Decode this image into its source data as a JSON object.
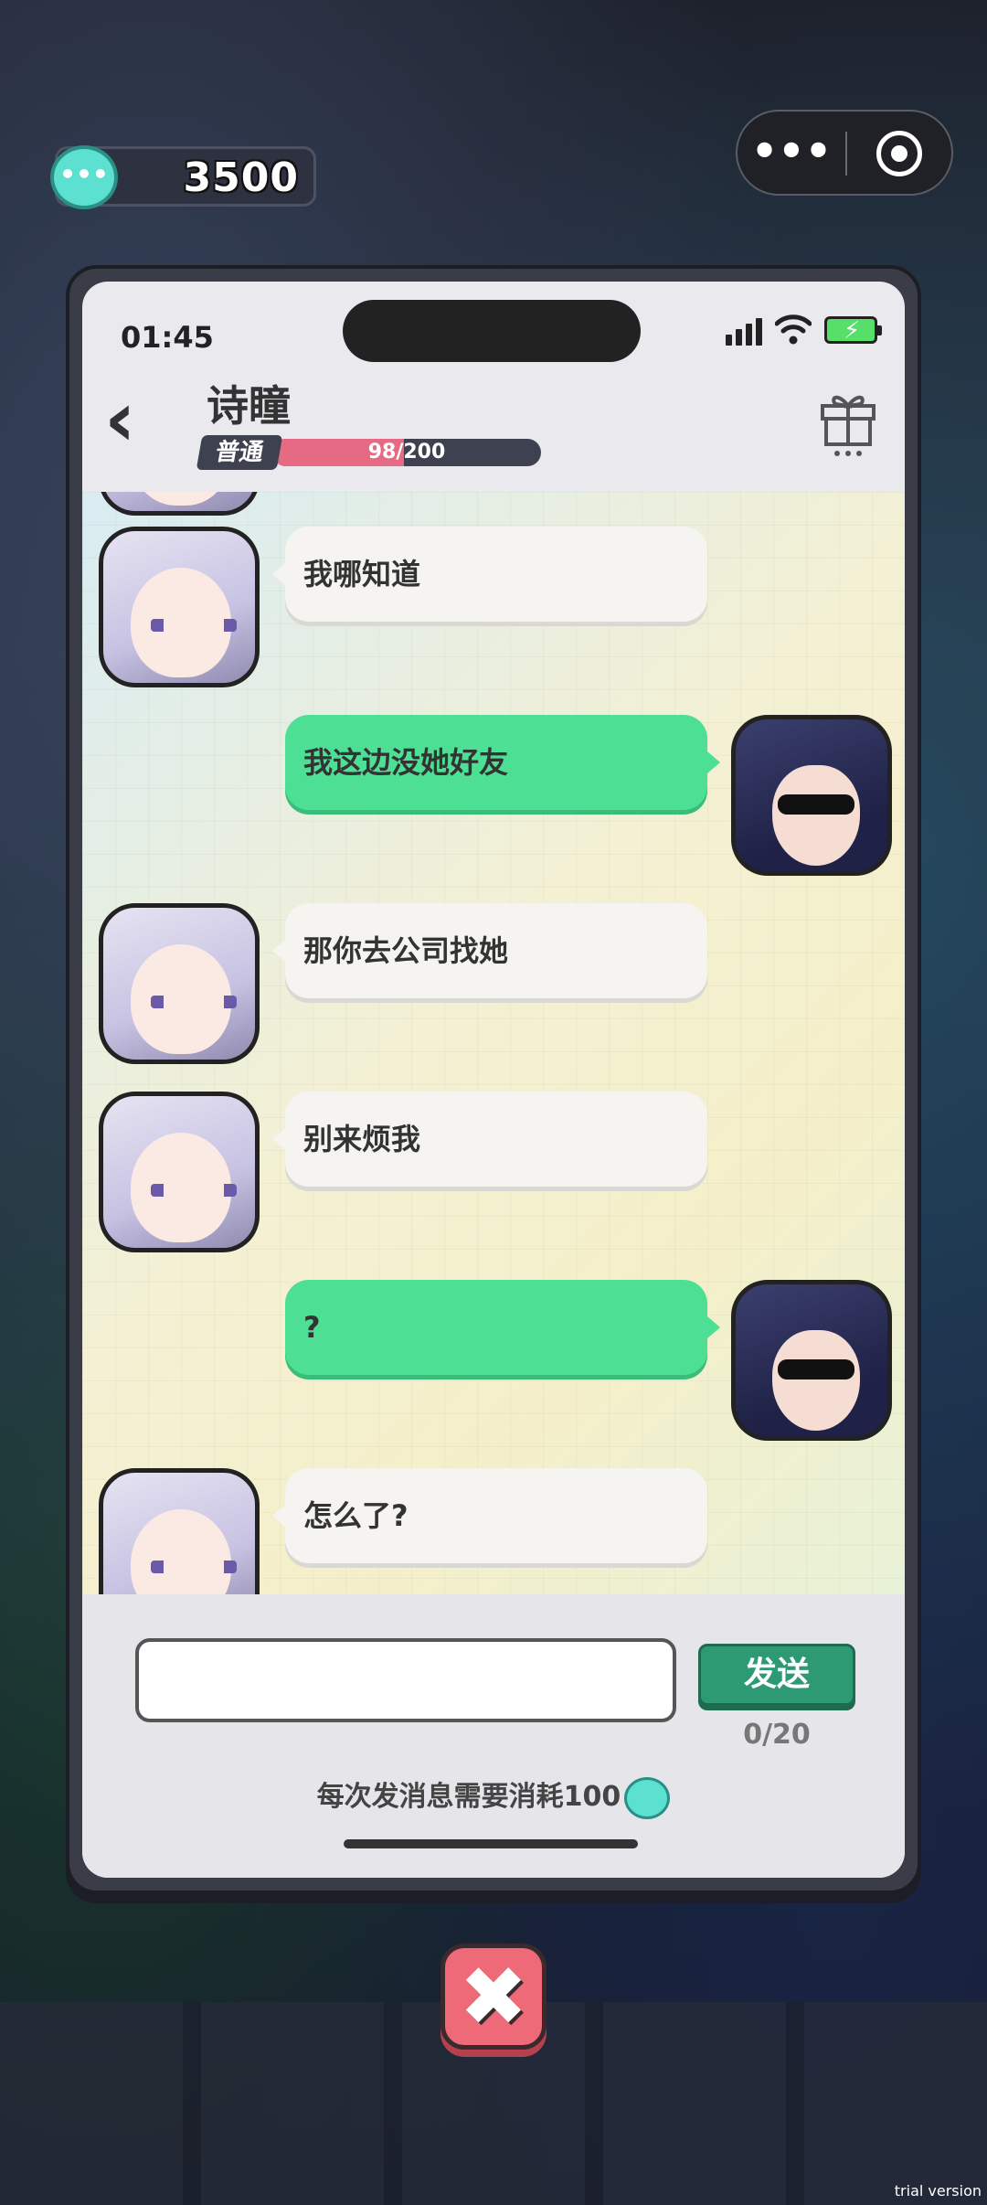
{
  "currency": {
    "amount": "3500",
    "icon": "chat-coin-icon"
  },
  "capsule": {
    "more_label": "•••"
  },
  "phone": {
    "status": {
      "time": "01:45"
    },
    "header": {
      "contact_name": "诗瞳",
      "relation_level": "普通",
      "relation_progress": "98/200",
      "relation_fraction": 0.49
    }
  },
  "messages": [
    {
      "side": "in",
      "avatar": "silver-hair-girl",
      "text": "我哪知道"
    },
    {
      "side": "out",
      "avatar": "sunglasses-lady",
      "text": "我这边没她好友"
    },
    {
      "side": "in",
      "avatar": "silver-hair-girl",
      "text": "那你去公司找她"
    },
    {
      "side": "in",
      "avatar": "silver-hair-girl",
      "text": "别来烦我"
    },
    {
      "side": "out",
      "avatar": "sunglasses-lady",
      "text": "?"
    },
    {
      "side": "in",
      "avatar": "silver-hair-girl",
      "text": "怎么了?"
    }
  ],
  "input": {
    "value": "",
    "send_label": "发送",
    "char_count": "0/20",
    "cost_note": "每次发消息需要消耗100"
  },
  "close_label": "✖",
  "watermark": "trial version",
  "colors": {
    "outgoing_bubble": "#4ddf94",
    "incoming_bubble": "#f5f4f1",
    "send_button": "#2e9a74",
    "close_button": "#ee6a78",
    "relation_fill": "#e76a84"
  }
}
